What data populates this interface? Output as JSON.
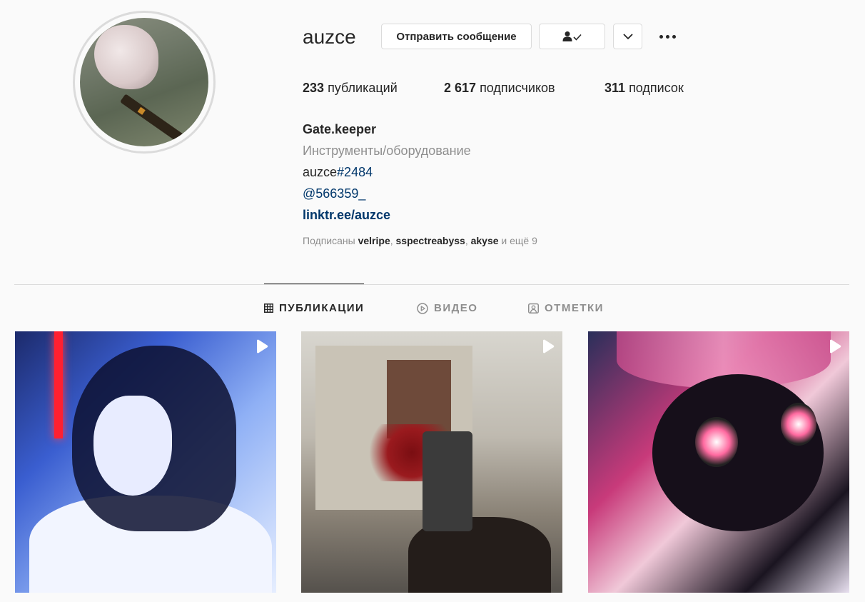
{
  "profile": {
    "username": "auzce",
    "message_button": "Отправить сообщение",
    "stats": {
      "posts_count": "233",
      "posts_label": "публикаций",
      "followers_count": "2 617",
      "followers_label": "подписчиков",
      "following_count": "311",
      "following_label": "подписок"
    },
    "bio": {
      "name": "Gate.keeper",
      "category": "Инструменты/оборудование",
      "line1_text": "auzce",
      "line1_tag": "#2484",
      "line2": "@566359_",
      "link": "linktr.ee/auzce"
    },
    "followed_by": {
      "prefix": "Подписаны",
      "user1": "velripe",
      "user2": "sspectreabyss",
      "user3": "akyse",
      "suffix": "и ещё 9"
    }
  },
  "tabs": [
    {
      "label": "ПУБЛИКАЦИИ",
      "icon": "grid-icon",
      "active": true
    },
    {
      "label": "ВИДЕО",
      "icon": "play-circle-icon",
      "active": false
    },
    {
      "label": "ОТМЕТКИ",
      "icon": "tag-user-icon",
      "active": false
    }
  ],
  "colors": {
    "background": "#fafafa",
    "text": "#262626",
    "secondary": "#8e8e8e",
    "link": "#00376b",
    "border": "#dbdbdb"
  }
}
